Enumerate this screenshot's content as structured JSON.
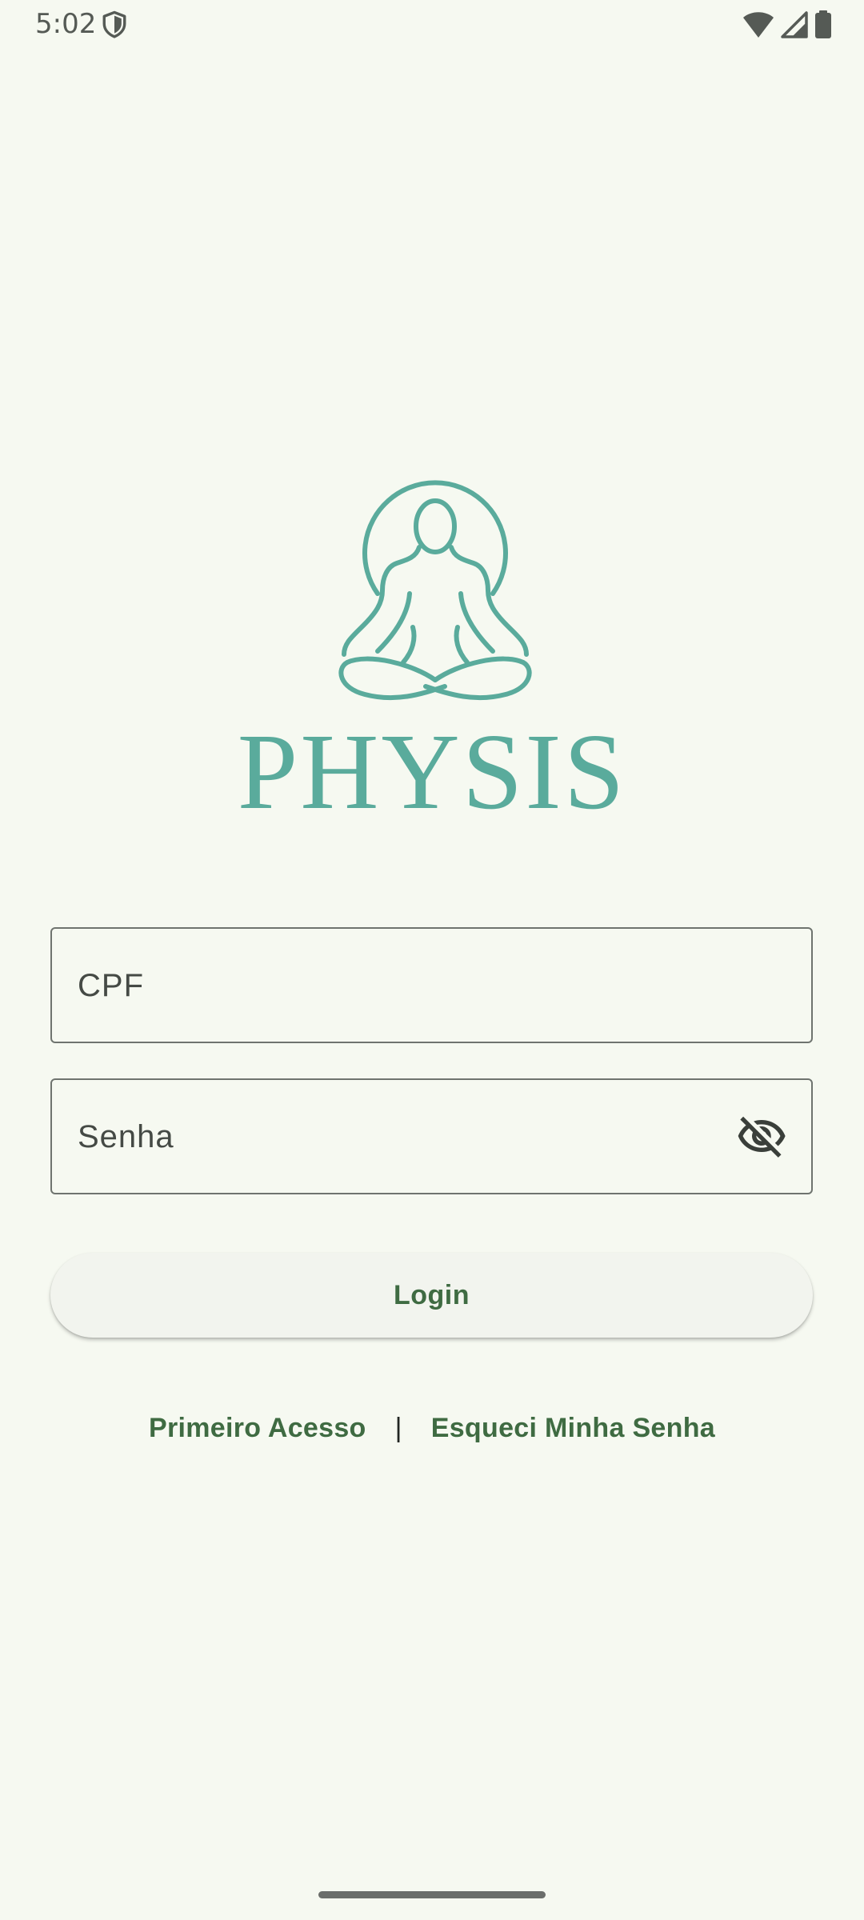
{
  "status_bar": {
    "time": "5:02",
    "icons": [
      "shield-icon",
      "wifi-icon",
      "signal-icon",
      "battery-icon"
    ]
  },
  "brand": {
    "name": "PHYSIS",
    "logo_icon": "meditation-figure-icon",
    "color": "#5aab9c"
  },
  "form": {
    "cpf": {
      "placeholder": "CPF",
      "value": ""
    },
    "senha": {
      "placeholder": "Senha",
      "value": "",
      "toggle_icon": "eye-off-icon"
    },
    "login_label": "Login"
  },
  "links": {
    "first_access": "Primeiro Acesso",
    "separator": "|",
    "forgot_password": "Esqueci Minha Senha"
  },
  "colors": {
    "background": "#f6f9f1",
    "accent_text": "#3f6b42",
    "border": "#6f746f"
  }
}
